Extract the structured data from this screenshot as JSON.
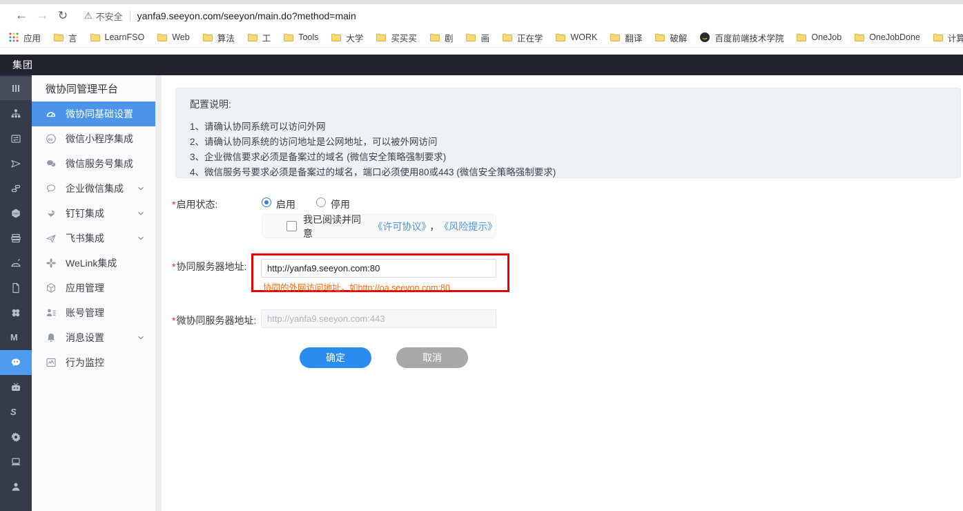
{
  "browser": {
    "back": "←",
    "forward": "→",
    "reload": "↻",
    "warning": "⚠",
    "security_label": "不安全",
    "url": "yanfa9.seeyon.com/seeyon/main.do?method=main",
    "bookmarks": [
      {
        "icon": "apps-grid-icon",
        "label": "应用"
      },
      {
        "icon": "folder-icon",
        "label": "言"
      },
      {
        "icon": "folder-icon",
        "label": "LearnFSO"
      },
      {
        "icon": "folder-icon",
        "label": "Web"
      },
      {
        "icon": "folder-icon",
        "label": "算法"
      },
      {
        "icon": "folder-icon",
        "label": "工"
      },
      {
        "icon": "folder-icon",
        "label": "Tools"
      },
      {
        "icon": "folder-icon",
        "label": "大学"
      },
      {
        "icon": "folder-icon",
        "label": "买买买"
      },
      {
        "icon": "folder-icon",
        "label": "剧"
      },
      {
        "icon": "folder-icon",
        "label": "画"
      },
      {
        "icon": "folder-icon",
        "label": "正在学"
      },
      {
        "icon": "folder-icon",
        "label": "WORK"
      },
      {
        "icon": "folder-icon",
        "label": "翻译"
      },
      {
        "icon": "folder-icon",
        "label": "破解"
      },
      {
        "icon": "site-favicon",
        "label": "百度前端技术学院"
      },
      {
        "icon": "folder-icon",
        "label": "OneJob"
      },
      {
        "icon": "folder-icon",
        "label": "OneJobDone"
      },
      {
        "icon": "folder-icon",
        "label": "计算机"
      }
    ]
  },
  "topbar": {
    "title": "集团"
  },
  "rail": {
    "items": [
      {
        "icon": "menu-bars-icon",
        "topbox": true
      },
      {
        "icon": "org-chart-icon"
      },
      {
        "icon": "transfer-card-icon"
      },
      {
        "icon": "send-plane-icon"
      },
      {
        "icon": "link-chain-icon"
      },
      {
        "icon": "cad-badge-icon"
      },
      {
        "icon": "layers-icon"
      },
      {
        "icon": "palette-icon"
      },
      {
        "icon": "document-icon"
      },
      {
        "icon": "clover-icon"
      },
      {
        "icon": "letter-m-icon"
      },
      {
        "icon": "wechat-icon",
        "active": true
      },
      {
        "icon": "tv-icon"
      },
      {
        "icon": "stripe-s-icon"
      },
      {
        "icon": "gear-icon"
      },
      {
        "icon": "laptop-icon"
      },
      {
        "icon": "user-icon"
      }
    ]
  },
  "sidebar": {
    "title": "微协同管理平台",
    "items": [
      {
        "label": "微协同基础设置",
        "icon": "dashboard-gauge-icon",
        "selected": true
      },
      {
        "label": "微信小程序集成",
        "icon": "miniprogram-icon"
      },
      {
        "label": "微信服务号集成",
        "icon": "service-account-icon"
      },
      {
        "label": "企业微信集成",
        "icon": "enterprise-wechat-icon",
        "chevron": true
      },
      {
        "label": "钉钉集成",
        "icon": "dingtalk-icon",
        "chevron": true
      },
      {
        "label": "飞书集成",
        "icon": "feishu-icon",
        "chevron": true
      },
      {
        "label": "WeLink集成",
        "icon": "welink-icon"
      },
      {
        "label": "应用管理",
        "icon": "app-manage-icon"
      },
      {
        "label": "账号管理",
        "icon": "account-manage-icon"
      },
      {
        "label": "消息设置",
        "icon": "bell-icon",
        "chevron": true
      },
      {
        "label": "行为监控",
        "icon": "monitor-chart-icon"
      }
    ]
  },
  "main": {
    "notice": {
      "title": "配置说明:",
      "lines": [
        "1、请确认协同系统可以访问外网",
        "2、请确认协同系统的访问地址是公网地址，可以被外网访问",
        "3、企业微信要求必须是备案过的域名 (微信安全策略强制要求)",
        "4、微信服务号要求必须是备案过的域名，端口必须使用80或443 (微信安全策略强制要求)"
      ]
    },
    "form": {
      "required_mark": "*",
      "status_label": "启用状态:",
      "enable_label": "启用",
      "disable_label": "停用",
      "agreement_prefix": "我已阅读并同意",
      "license_link": "《许可协议》",
      "separator": "，",
      "risk_link": "《风险提示》",
      "server_label": "协同服务器地址:",
      "server_value": "http://yanfa9.seeyon.com:80",
      "server_hint": "协同的外网访问地址，如http://oa.seeyon.com:80",
      "wx_label": "微协同服务器地址:",
      "wx_placeholder": "http://yanfa9.seeyon.com:443",
      "ok_label": "确定",
      "cancel_label": "取消"
    }
  },
  "colors": {
    "accent_blue": "#4b94ea",
    "primary_button": "#2b8cf0",
    "hint_orange": "#ff6600",
    "annotation_red": "#e60000",
    "topbar_dark": "#21242e",
    "rail_dark": "#353b49"
  }
}
